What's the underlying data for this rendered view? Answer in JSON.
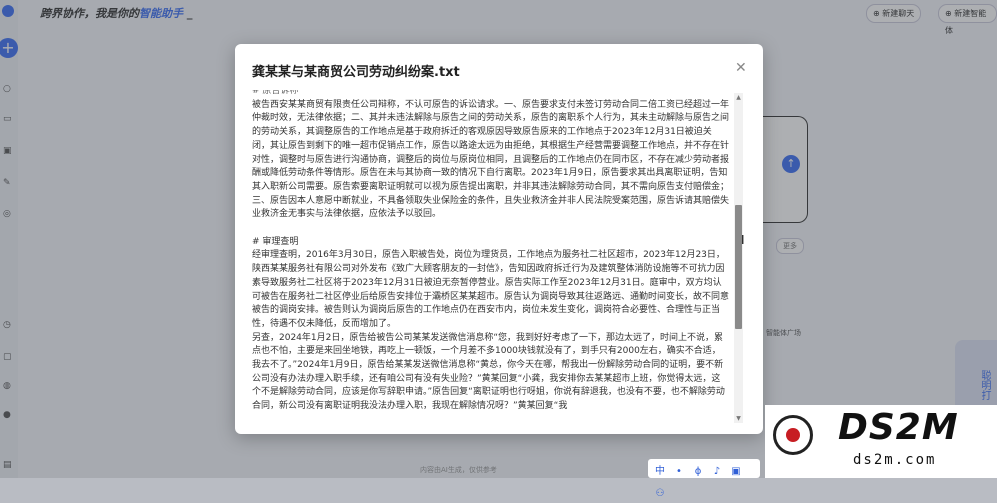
{
  "app": {
    "title_prefix": "跨界协作，我是你的",
    "title_highlight": "智能助手",
    "title_suffix": " _",
    "new_chat_label": "新建聊天",
    "new_agent_label": "新建智能体",
    "more_label": "更多",
    "agent_plaza_label": "智能体广场",
    "side_card_text": "聪明打",
    "disclaimer": "内容由AI生成，仅供参考"
  },
  "modal": {
    "title": "龚某某与某商贸公司劳动纠纷案.txt",
    "close_icon": "close-icon",
    "lines_cut": "# 原告诉称",
    "paragraph1": "被告西安某某商贸有限责任公司辩称，不认可原告的诉讼请求。一、原告要求支付未签订劳动合同二倍工资已经超过一年仲裁时效，无法律依据；二、其并未违法解除与原告之间的劳动关系，原告的离职系个人行为，其未主动解除与原告之间的劳动关系，其调整原告的工作地点是基于政府拆迁的客观原因导致原告原来的工作地点于2023年12月31日被迫关闭，其让原告到剩下的唯一超市促销点工作，原告以路途太远为由拒绝，其根据生产经营需要调整工作地点，并不存在针对性，调整时与原告进行沟通协商，调整后的岗位与原岗位相同，且调整后的工作地点仍在同市区，不存在减少劳动者报酬或降低劳动条件等情形。原告在未与其协商一致的情况下自行离职。2023年1月9日，原告要求其出具离职证明，告知其入职新公司需要。原告索要离职证明就可以视为原告提出离职，并非其违法解除劳动合同，其不需向原告支付赔偿金；三、原告因本人意愿中断就业，不具备领取失业保险金的条件，且失业救济金并非人民法院受案范围，原告诉请其赔偿失业救济金无事实与法律依据，应依法予以驳回。",
    "heading2": "# 审理查明",
    "paragraph2": "经审理查明，2016年3月30日，原告入职被告处，岗位为理货员，工作地点为服务社二社区超市，2023年12月23日，陕西某某服务社有限公司对外发布《致广大顾客朋友的一封信》，告知因政府拆迁行为及建筑整体消防设施等不可抗力因素导致服务社二社区将于2023年12月31日被迫无奈暂停营业。原告实际工作至2023年12月31日。庭审中，双方均认可被告在服务社二社区停业后给原告安排位于灞桥区某某超市。原告认为调岗导致其往返路远、通勤时间变长，故不同意被告的调岗安排。被告则认为调岗后原告的工作地点仍在西安市内，岗位未发生变化，调岗符合必要性、合理性与正当性，待遇不仅未降低，反而增加了。",
    "paragraph3": "另查，2024年1月2日，原告给被告公司某某发送微信消息称“您，我到好好考虑了一下，那边太远了，时间上不说，累点也不怕，主要是来回坐地铁，再吃上一顿饭，一个月差不多1000块钱就没有了，到手只有2000左右，确实不合适，我去不了。”2024年1月9日，原告给某某发送微信消息称“黄总，你今天在哪，帮我出一份解除劳动合同的证明，要不新公司没有办法办理入职手续，还有咱公司有没有失业险？”黄某回复“小龚，我安排你去某某超市上班，你觉得太远，这个不是解除劳动合同，应该是你写辞职申请。”原告回复“离职证明也行呀姐，你说有辞退我，也没有不要，也不解除劳动合同，新公司没有离职证明我没法办理入职，我现在解除情况呀？”黄某回复“我"
  },
  "toolbar": {
    "items": [
      "中",
      "•",
      "ϕ",
      "♪",
      "▣",
      "⚇"
    ]
  },
  "watermark": {
    "brand": "DS2M",
    "url": "ds2m.com"
  }
}
